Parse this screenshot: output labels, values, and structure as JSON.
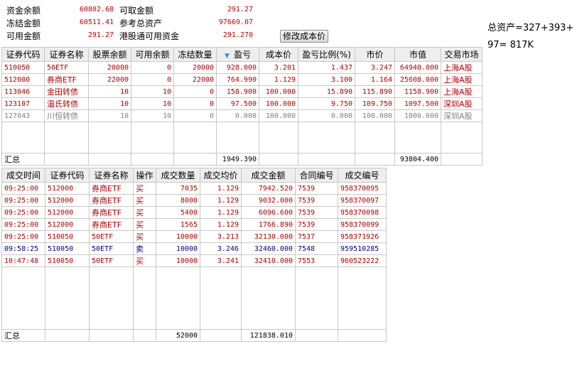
{
  "summary": {
    "cash_balance_label": "资金余额",
    "cash_balance_value": "60802.68",
    "withdrawable_label": "可取金额",
    "withdrawable_value": "291.27",
    "frozen_label": "冻结金额",
    "frozen_value": "60511.41",
    "ref_total_assets_label": "参考总资产",
    "ref_total_assets_value": "97669.07",
    "available_label": "可用金额",
    "available_value": "291.27",
    "hk_connect_label": "港股通可用资金",
    "hk_connect_value": "291.270",
    "edit_cost_button": "修改成本价"
  },
  "side_note": {
    "line1": "总资产=327+393+",
    "line2": "97=  817K"
  },
  "positions": {
    "columns": [
      "证券代码",
      "证券名称",
      "股票余额",
      "可用余额",
      "冻结数量",
      "盈亏",
      "成本价",
      "盈亏比例(%)",
      "市价",
      "市值",
      "交易市场"
    ],
    "rows": [
      {
        "code": "510050",
        "name": "50ETF",
        "balance": "20000",
        "available": "0",
        "frozen": "20000",
        "pnl": "928.000",
        "cost": "3.201",
        "pnl_pct": "1.437",
        "price": "3.247",
        "value": "64940.000",
        "market": "上海A股"
      },
      {
        "code": "512000",
        "name": "券商ETF",
        "balance": "22000",
        "available": "0",
        "frozen": "22000",
        "pnl": "764.990",
        "cost": "1.129",
        "pnl_pct": "3.100",
        "price": "1.164",
        "value": "25608.000",
        "market": "上海A股"
      },
      {
        "code": "113046",
        "name": "金田转债",
        "balance": "10",
        "available": "10",
        "frozen": "0",
        "pnl": "158.900",
        "cost": "100.000",
        "pnl_pct": "15.890",
        "price": "115.890",
        "value": "1158.900",
        "market": "上海A股"
      },
      {
        "code": "123107",
        "name": "温氏转债",
        "balance": "10",
        "available": "10",
        "frozen": "0",
        "pnl": "97.500",
        "cost": "100.000",
        "pnl_pct": "9.750",
        "price": "109.750",
        "value": "1097.500",
        "market": "深圳A股"
      },
      {
        "code": "127043",
        "name": "川恒转债",
        "balance": "10",
        "available": "10",
        "frozen": "0",
        "pnl": "0.000",
        "cost": "100.000",
        "pnl_pct": "0.000",
        "price": "100.000",
        "value": "1000.000",
        "market": "深圳A股"
      }
    ],
    "total_label": "汇总",
    "total_pnl": "1949.390",
    "total_value": "93804.400"
  },
  "trades": {
    "columns": [
      "成交时间",
      "证券代码",
      "证券名称",
      "操作",
      "成交数量",
      "成交均价",
      "成交金额",
      "合同编号",
      "成交编号"
    ],
    "rows": [
      {
        "time": "09:25:00",
        "code": "512000",
        "name": "券商ETF",
        "op": "买",
        "qty": "7035",
        "avg": "1.129",
        "amount": "7942.520",
        "contract": "7539",
        "deal": "958370095"
      },
      {
        "time": "09:25:00",
        "code": "512000",
        "name": "券商ETF",
        "op": "买",
        "qty": "8000",
        "avg": "1.129",
        "amount": "9032.000",
        "contract": "7539",
        "deal": "958370097"
      },
      {
        "time": "09:25:00",
        "code": "512000",
        "name": "券商ETF",
        "op": "买",
        "qty": "5400",
        "avg": "1.129",
        "amount": "6096.600",
        "contract": "7539",
        "deal": "958370098"
      },
      {
        "time": "09:25:00",
        "code": "512000",
        "name": "券商ETF",
        "op": "买",
        "qty": "1565",
        "avg": "1.129",
        "amount": "1766.890",
        "contract": "7539",
        "deal": "958370099"
      },
      {
        "time": "09:25:00",
        "code": "510050",
        "name": "50ETF",
        "op": "买",
        "qty": "10000",
        "avg": "3.213",
        "amount": "32130.000",
        "contract": "7537",
        "deal": "958371926"
      },
      {
        "time": "09:58:25",
        "code": "510050",
        "name": "50ETF",
        "op": "卖",
        "qty": "10000",
        "avg": "3.246",
        "amount": "32460.000",
        "contract": "7548",
        "deal": "959510285"
      },
      {
        "time": "10:47:48",
        "code": "510050",
        "name": "50ETF",
        "op": "买",
        "qty": "10000",
        "avg": "3.241",
        "amount": "32410.000",
        "contract": "7553",
        "deal": "960523222"
      }
    ],
    "total_label": "汇总",
    "total_qty": "52000",
    "total_amount": "121838.010"
  },
  "colors": {
    "buy": "#b00000",
    "sell": "#00008b",
    "inactive": "#808080",
    "sort_indicator": "#3399cc"
  }
}
